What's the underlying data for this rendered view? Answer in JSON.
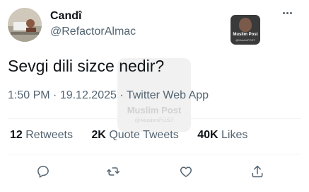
{
  "author": {
    "display_name": "Candî",
    "handle": "@RefactorAlmac"
  },
  "badge": {
    "title": "Muslim Post",
    "subtitle": "@MuslimPOST"
  },
  "watermark": {
    "title": "Muslim Post",
    "subtitle": "@MuslimPOST"
  },
  "tweet": {
    "text": "Sevgi dili sizce nedir?",
    "time": "1:50 PM",
    "separator1": " · ",
    "date": "19.12.2025",
    "separator2": " · ",
    "source": "Twitter Web App"
  },
  "stats": {
    "retweets_count": "12",
    "retweets_label": "Retweets",
    "quotes_count": "2K",
    "quotes_label": "Quote Tweets",
    "likes_count": "40K",
    "likes_label": "Likes"
  },
  "icons": {
    "more": "more-horizontal-icon",
    "reply": "reply-icon",
    "retweet": "retweet-icon",
    "like": "like-icon",
    "share": "share-icon"
  },
  "colors": {
    "text_primary": "#0f1419",
    "text_secondary": "#536471",
    "divider": "#eff3f4",
    "background": "#ffffff"
  }
}
